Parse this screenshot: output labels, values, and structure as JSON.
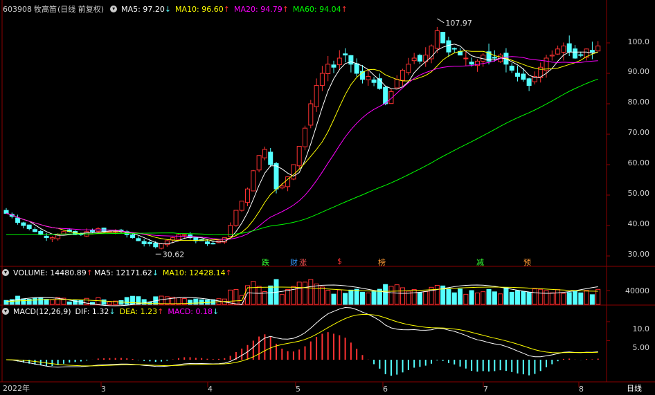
{
  "header": {
    "code": "603908",
    "name": "牧高笛",
    "mode": "(日线 前复权)",
    "ma5": {
      "label": "MA5:",
      "value": "97.20",
      "dir": "↓",
      "color": "#ffffff"
    },
    "ma10": {
      "label": "MA10:",
      "value": "96.60",
      "dir": "↑",
      "color": "#ffff00"
    },
    "ma20": {
      "label": "MA20:",
      "value": "94.79",
      "dir": "↑",
      "color": "#ff00ff"
    },
    "ma60": {
      "label": "MA60:",
      "value": "94.04",
      "dir": "↑",
      "color": "#00ff00"
    }
  },
  "volume_header": {
    "label": "VOLUME:",
    "value": "14480.89",
    "value_dir": "↑",
    "ma5": "MA5: 12171.62",
    "ma5_dir": "↓",
    "ma10": "MA10: 12428.14",
    "ma10_dir": "↑"
  },
  "macd_header": {
    "label": "MACD(12,26,9)",
    "dif": "DIF: 1.32",
    "dif_dir": "↓",
    "dea": "DEA: 1.23",
    "dea_dir": "↑",
    "macd": "MACD: 0.18",
    "macd_dir": "↓"
  },
  "price_axis": [
    "100.0",
    "90.00",
    "80.00",
    "70.00",
    "60.00",
    "50.00",
    "40.00",
    "30.00"
  ],
  "volume_axis": [
    "40000"
  ],
  "macd_axis": [
    "10.0",
    "5.00"
  ],
  "date_axis": [
    "2022年",
    "3",
    "4",
    "5",
    "6",
    "7",
    "8"
  ],
  "period_label": "日线",
  "annotations": {
    "high": "107.97",
    "low": "30.62"
  },
  "events": [
    {
      "text": "跌",
      "color": "#33ff33"
    },
    {
      "text": "财",
      "color": "#3399ff"
    },
    {
      "text": "涨",
      "color": "#ff5555"
    },
    {
      "text": "$",
      "color": "#ff3333"
    },
    {
      "text": "榜",
      "color": "#ff9933"
    },
    {
      "text": "减",
      "color": "#33ff33"
    },
    {
      "text": "预",
      "color": "#ff9933"
    }
  ],
  "colors": {
    "up": "#ff3232",
    "down": "#54ffff",
    "grid": "#8b0000",
    "ma5": "#ffffff",
    "ma10": "#ffff00",
    "ma20": "#ff00ff",
    "ma60": "#00ff00"
  },
  "chart_data": {
    "type": "candlestick",
    "title": "603908 牧高笛 (日线 前复权)",
    "price_range": [
      27,
      110
    ],
    "high": 107.97,
    "low": 30.62,
    "closes": [
      44,
      43,
      41,
      40,
      39,
      38,
      37,
      36,
      36,
      37,
      38,
      38,
      37,
      37,
      38,
      38,
      39,
      38,
      38,
      38,
      38,
      37,
      36,
      35,
      34,
      34,
      33,
      34,
      35,
      36,
      37,
      37,
      36,
      35,
      35,
      34,
      34,
      35,
      36,
      40,
      45,
      48,
      52,
      58,
      63,
      65,
      60,
      52,
      53,
      56,
      60,
      66,
      72,
      80,
      86,
      90,
      93,
      92,
      95,
      96,
      93,
      90,
      88,
      89,
      87,
      85,
      80,
      84,
      88,
      91,
      93,
      95,
      94,
      96,
      99,
      104,
      100,
      97,
      98,
      96,
      95,
      93,
      94,
      96,
      94,
      95,
      96,
      93,
      91,
      89,
      88,
      86,
      89,
      92,
      95,
      96,
      98,
      99,
      97,
      95,
      96,
      98,
      97,
      99
    ]
  }
}
